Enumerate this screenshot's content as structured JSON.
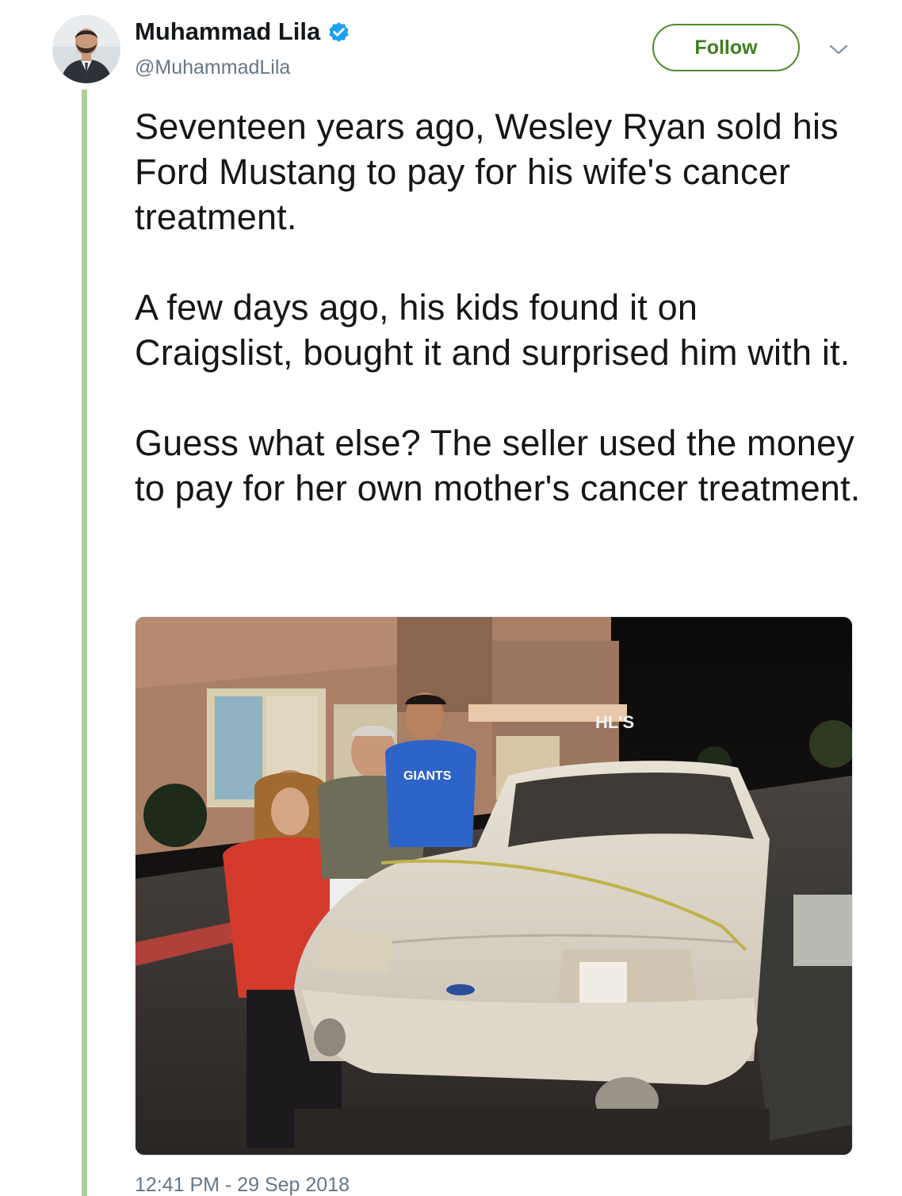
{
  "author": {
    "display_name": "Muhammad Lila",
    "handle": "@MuhammadLila",
    "verified": true
  },
  "actions": {
    "follow_label": "Follow"
  },
  "tweet": {
    "paragraphs": [
      "Seventeen years ago, Wesley Ryan sold his Ford Mustang to pay for his wife's cancer treatment.",
      "A few days ago, his kids found it on Craigslist, bought it and surprised him with it.",
      "Guess what else? The seller used the money to pay for her own mother's cancer treatment."
    ],
    "timestamp": "12:41 PM - 29 Sep 2018"
  },
  "photo": {
    "store_sign": "HL'S",
    "shirt_text": "GIANTS"
  },
  "colors": {
    "follow_green": "#3f7f1f",
    "thread_line": "#aecd9c",
    "verified_blue": "#1da1f2",
    "muted_text": "#657786"
  },
  "icons": {
    "verified": "verified-badge-icon",
    "caret": "chevron-down-icon"
  }
}
